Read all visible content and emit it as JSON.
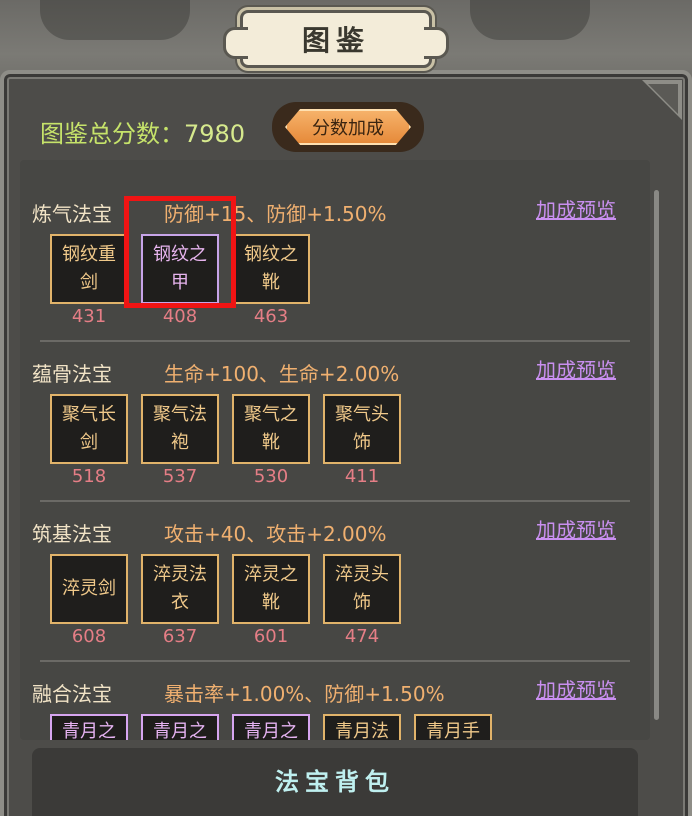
{
  "title": "图鉴",
  "score": {
    "label": "图鉴总分数：",
    "value": "7980"
  },
  "bonus_button": "分数加成",
  "sections": [
    {
      "name": "炼气法宝",
      "bonus": "防御+15、防御+1.50%",
      "link": "加成预览",
      "items": [
        {
          "name": "钢纹重剑",
          "count": "431"
        },
        {
          "name": "钢纹之甲",
          "count": "408"
        },
        {
          "name": "钢纹之靴",
          "count": "463"
        }
      ]
    },
    {
      "name": "蕴骨法宝",
      "bonus": "生命+100、生命+2.00%",
      "link": "加成预览",
      "items": [
        {
          "name": "聚气长剑",
          "count": "518"
        },
        {
          "name": "聚气法袍",
          "count": "537"
        },
        {
          "name": "聚气之靴",
          "count": "530"
        },
        {
          "name": "聚气头饰",
          "count": "411"
        }
      ]
    },
    {
      "name": "筑基法宝",
      "bonus": "攻击+40、攻击+2.00%",
      "link": "加成预览",
      "items": [
        {
          "name": "淬灵剑",
          "count": "608"
        },
        {
          "name": "淬灵法衣",
          "count": "637"
        },
        {
          "name": "淬灵之靴",
          "count": "601"
        },
        {
          "name": "淬灵头饰",
          "count": "474"
        }
      ]
    },
    {
      "name": "融合法宝",
      "bonus": "暴击率+1.00%、防御+1.50%",
      "link": "加成预览",
      "items": [
        {
          "name": "青月之"
        },
        {
          "name": "青月之"
        },
        {
          "name": "青月之"
        },
        {
          "name": "青月法"
        },
        {
          "name": "青月手"
        }
      ]
    }
  ],
  "backpack_title": "法宝背包",
  "colors": {
    "item_border": "#e1b36a",
    "item_border_purple": "#d6a5f0",
    "count": "#e57e86",
    "highlight": "#f01414"
  }
}
